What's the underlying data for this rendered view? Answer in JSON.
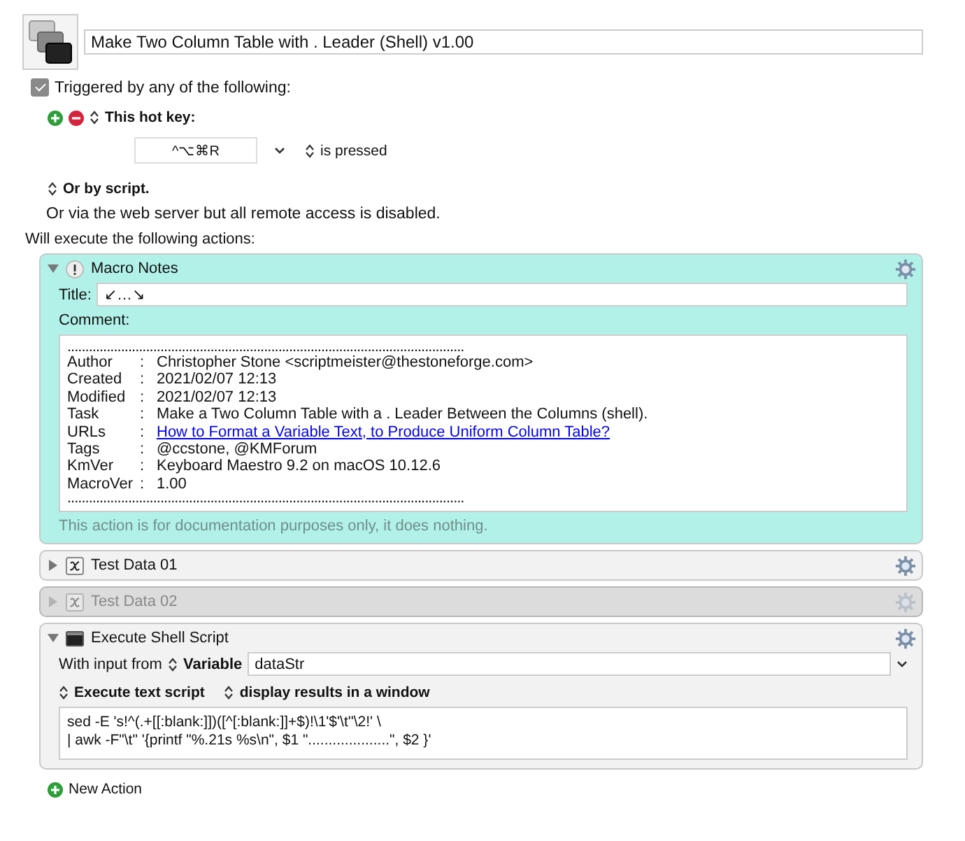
{
  "macro": {
    "name": "Make Two Column Table with . Leader (Shell) v1.00"
  },
  "trigger": {
    "checked": true,
    "label": "Triggered by any of the following:"
  },
  "hotkey": {
    "label": "This hot key:",
    "keys": "^⌥⌘R",
    "condition": "is pressed"
  },
  "script_trigger": "Or by script.",
  "web_server": "Or via the web server but all remote access is disabled.",
  "actions_heading": "Will execute the following actions:",
  "actions": [
    {
      "kind": "notes",
      "title": "Macro Notes",
      "expanded": true,
      "disabled": false,
      "title_label": "Title:",
      "title_value": "↙…↘",
      "comment_label": "Comment:",
      "comment_lines": [
        {
          "kind": "rule",
          "text": "..............................................................................................................."
        },
        {
          "kind": "field",
          "key": "Author",
          "sep": ":",
          "value": "Christopher Stone <scriptmeister@thestoneforge.com>"
        },
        {
          "kind": "field",
          "key": "Created",
          "sep": ":",
          "value": "2021/02/07 12:13"
        },
        {
          "kind": "field",
          "key": "Modified",
          "sep": ":",
          "value": "2021/02/07 12:13"
        },
        {
          "kind": "field",
          "key": "Task",
          "sep": ":",
          "value": "Make a Two Column Table with a . Leader Between the Columns (shell)."
        },
        {
          "kind": "link",
          "key": "URLs",
          "sep": ":",
          "value": "How to Format a Variable Text, to Produce Uniform Column Table?"
        },
        {
          "kind": "field",
          "key": "Tags",
          "sep": ":",
          "value": "@ccstone, @KMForum"
        },
        {
          "kind": "field",
          "key": "KmVer",
          "sep": ":",
          "value": "Keyboard Maestro 9.2 on macOS 10.12.6"
        },
        {
          "kind": "field",
          "key": "MacroVer",
          "sep": ":",
          "value": "1.00"
        },
        {
          "kind": "rule",
          "text": "..............................................................................................................."
        }
      ],
      "footnote": "This action is for documentation purposes only, it does nothing."
    },
    {
      "kind": "variable",
      "title": "Test Data 01",
      "expanded": false,
      "disabled": false
    },
    {
      "kind": "variable",
      "title": "Test Data 02",
      "expanded": false,
      "disabled": true
    },
    {
      "kind": "shell",
      "title": "Execute Shell Script",
      "expanded": true,
      "disabled": false,
      "input_label": "With input from",
      "input_source": "Variable",
      "variable": "dataStr",
      "mode": "Execute text script",
      "output": "display results in a window",
      "script_lines": [
        "sed -E 's!^(.+[[:blank:]])([^[:blank:]]+$)!\\1'$'\\t''\\2!' \\",
        "| awk -F\"\\t\" '{printf \"%.21s %s\\n\", $1 \"....................\", $2 }'"
      ]
    }
  ],
  "new_action": "New Action"
}
